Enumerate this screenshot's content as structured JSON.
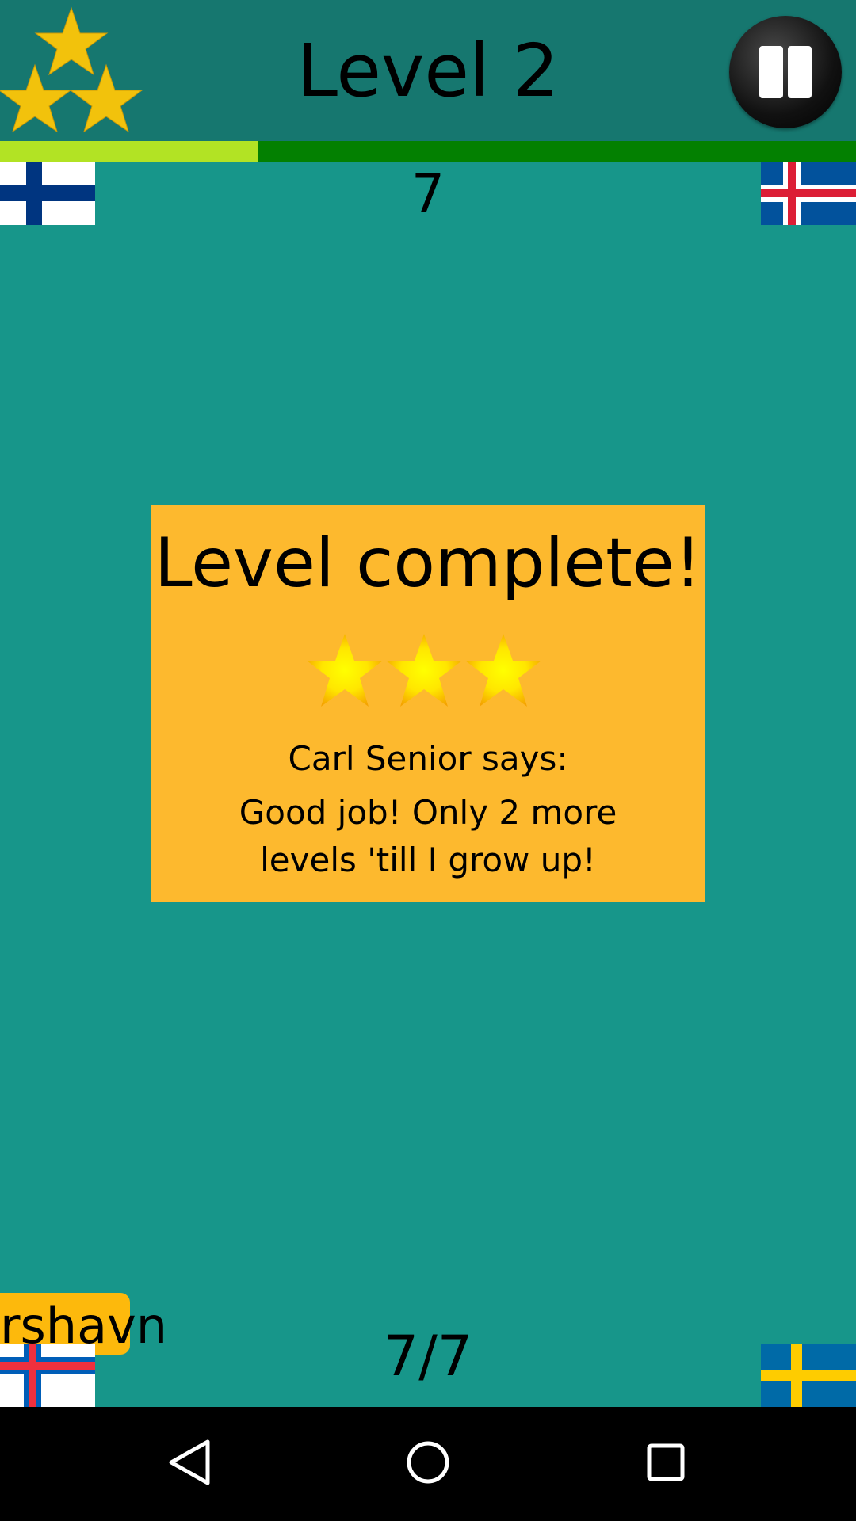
{
  "header": {
    "title": "Level 2",
    "stars_earned": 3,
    "stars_total": 3,
    "progress": 0.302
  },
  "game": {
    "counter": "7",
    "score": "7/7",
    "city_label": "rshavn",
    "flags": {
      "top_left": "finland-flag",
      "top_right": "iceland-flag",
      "bottom_left": "faroe-islands-flag",
      "bottom_right": "sweden-flag"
    }
  },
  "modal": {
    "title": "Level complete!",
    "stars": 3,
    "speaker": "Carl Senior says:",
    "message_line1": "Good job! Only 2 more",
    "message_line2": "levels 'till I grow up!"
  },
  "navigation": {
    "back_icon": "back-triangle-icon",
    "home_icon": "home-circle-icon",
    "recents_icon": "recents-square-icon"
  },
  "colors": {
    "background": "#17968a",
    "header": "#16776f",
    "progress_fill": "#b2e324",
    "progress_track": "#038001",
    "modal": "#fdb92e",
    "star_gold": "#f2c20c"
  }
}
